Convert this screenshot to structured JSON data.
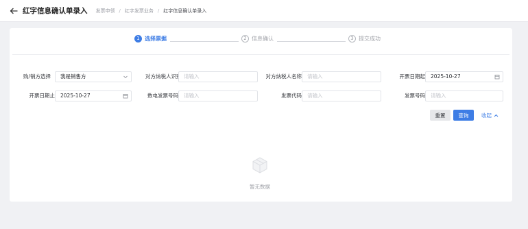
{
  "header": {
    "title": "红字信息确认单录入",
    "breadcrumb": [
      "发票申领",
      "红字发票业务",
      "红字信息确认单录入"
    ]
  },
  "steps": [
    {
      "num": "1",
      "label": "选择票据",
      "active": true
    },
    {
      "num": "2",
      "label": "信息确认",
      "active": false
    },
    {
      "num": "3",
      "label": "提交成功",
      "active": false
    }
  ],
  "form": {
    "buyer_seller": {
      "label": "购/销方选择",
      "value": "我是销售方"
    },
    "counterparty_taxid": {
      "label": "对方纳税人识别号",
      "placeholder": "请输入"
    },
    "counterparty_name": {
      "label": "对方纳税人名称",
      "placeholder": "请输入"
    },
    "date_start": {
      "label": "开票日期起",
      "value": "2025-10-27"
    },
    "date_end": {
      "label": "开票日期止",
      "value": "2025-10-27"
    },
    "einvoice_no": {
      "label": "数电发票号码",
      "placeholder": "请输入"
    },
    "invoice_code": {
      "label": "发票代码",
      "placeholder": "请输入"
    },
    "invoice_no": {
      "label": "发票号码",
      "placeholder": "请输入"
    }
  },
  "actions": {
    "reset_label": "重置",
    "query_label": "查询",
    "collapse_label": "收起"
  },
  "empty": {
    "text": "暂无数据"
  },
  "colors": {
    "primary": "#3e7de5",
    "background": "#f0f1f4"
  }
}
